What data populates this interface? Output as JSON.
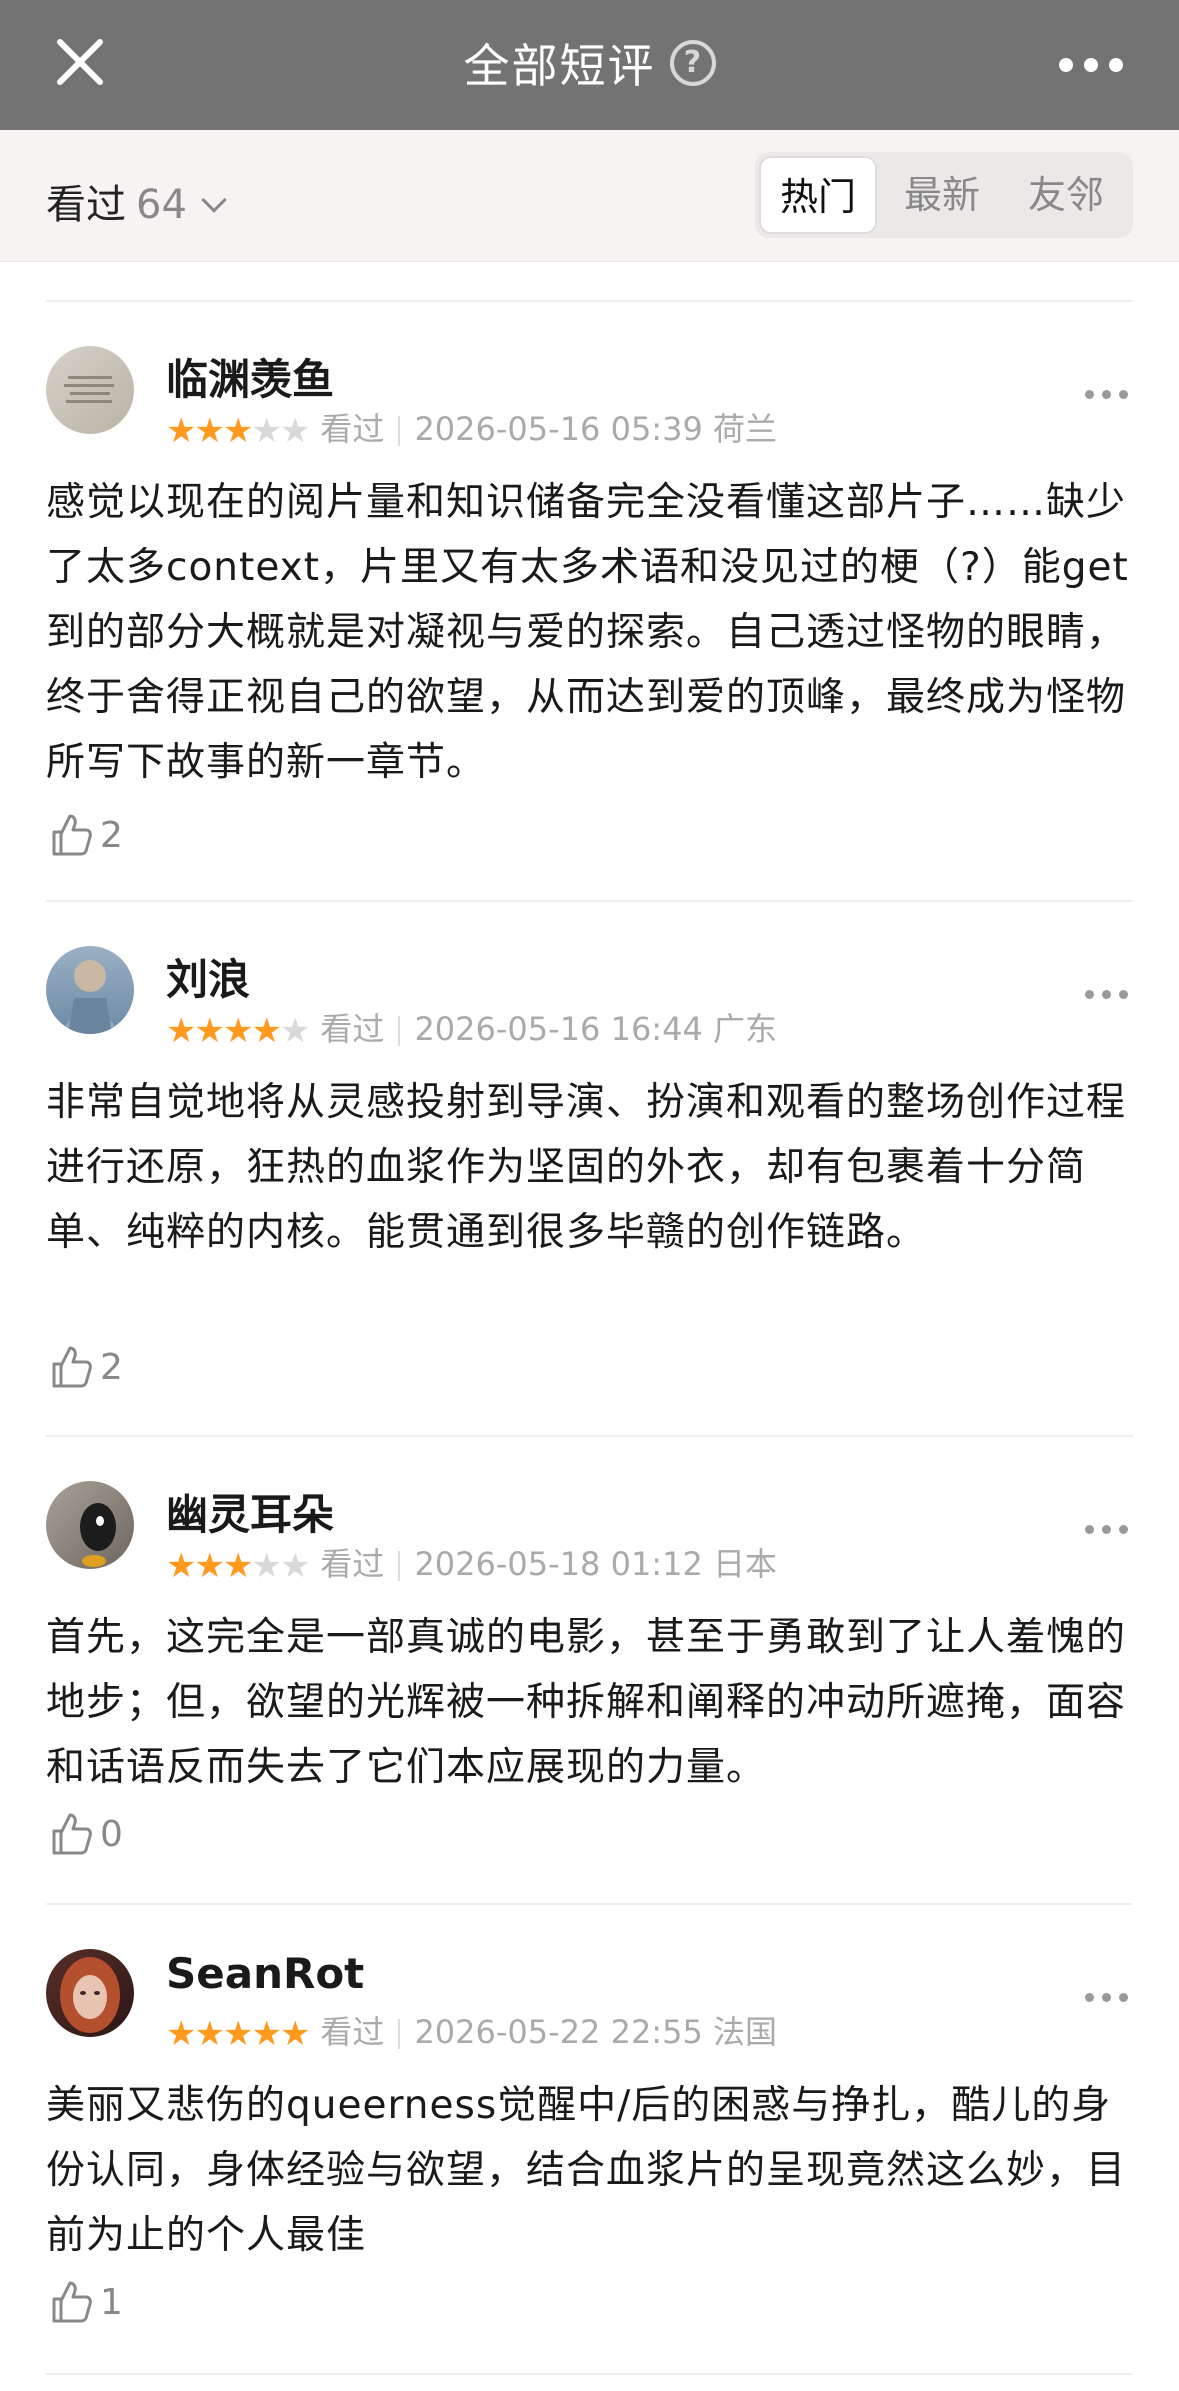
{
  "header": {
    "title": "全部短评",
    "help_icon": "?"
  },
  "filter": {
    "seen_label": "看过",
    "seen_count": "64",
    "tabs": [
      "热门",
      "最新",
      "友邻"
    ],
    "active_tab": "热门"
  },
  "colors": {
    "topbar": "#737373",
    "star_on": "#ff9a1f",
    "star_off": "#d9d9d9"
  },
  "reviews": [
    {
      "user": "临渊羡鱼",
      "rating": 3,
      "status": "看过",
      "time": "2026-05-16 05:39",
      "location": "荷兰",
      "text": "感觉以现在的阅片量和知识储备完全没看懂这部片子……缺少了太多context，片里又有太多术语和没见过的梗（?）能get到的部分大概就是对凝视与爱的探索。自己透过怪物的眼睛，终于舍得正视自己的欲望，从而达到爱的顶峰，最终成为怪物所写下故事的新一章节。",
      "likes": "2"
    },
    {
      "user": "刘浪",
      "rating": 4,
      "status": "看过",
      "time": "2026-05-16 16:44",
      "location": "广东",
      "text": "非常自觉地将从灵感投射到导演、扮演和观看的整场创作过程进行还原，狂热的血浆作为坚固的外衣，却有包裹着十分简单、纯粹的内核。能贯通到很多毕赣的创作链路。",
      "likes": "2"
    },
    {
      "user": "幽灵耳朵",
      "rating": 3,
      "status": "看过",
      "time": "2026-05-18 01:12",
      "location": "日本",
      "text": "首先，这完全是一部真诚的电影，甚至于勇敢到了让人羞愧的地步；但，欲望的光辉被一种拆解和阐释的冲动所遮掩，面容和话语反而失去了它们本应展现的力量。",
      "likes": "0"
    },
    {
      "user": "SeanRot",
      "rating": 5,
      "status": "看过",
      "time": "2026-05-22 22:55",
      "location": "法国",
      "text": "美丽又悲伤的queerness觉醒中/后的困惑与挣扎，酷儿的身份认同，身体经验与欲望，结合血浆片的呈现竟然这么妙，目前为止的个人最佳",
      "likes": "1"
    }
  ]
}
